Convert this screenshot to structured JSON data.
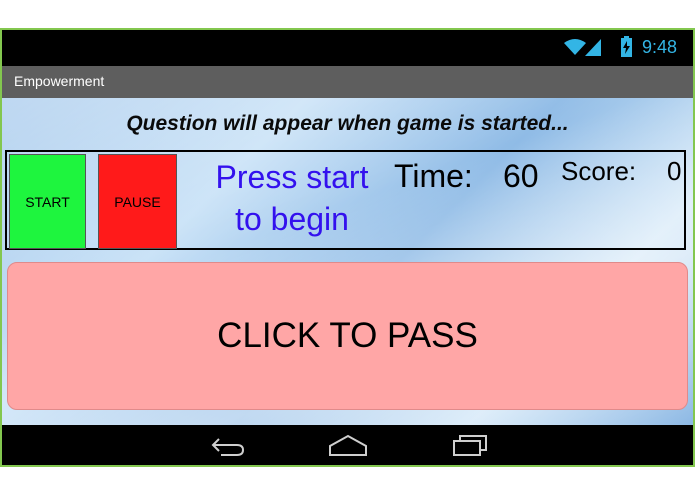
{
  "status_bar": {
    "time": "9:48",
    "icons": [
      "wifi-icon",
      "signal-icon",
      "battery-charging-icon"
    ],
    "accent_color": "#33b5e5"
  },
  "app": {
    "title": "Empowerment"
  },
  "game": {
    "question": "Question will appear when game is started...",
    "start_label": "START",
    "pause_label": "PAUSE",
    "message_line1": "Press start",
    "message_line2": "to begin",
    "time_label": "Time:",
    "time_value": "60",
    "score_label": "Score:",
    "score_value": "0",
    "pass_label": "CLICK TO PASS",
    "colors": {
      "start": "#1ef53e",
      "pause": "#ff1a1a",
      "pass": "#ffa6a6",
      "message": "#3311ee"
    }
  },
  "nav_bar": {
    "icons": [
      "back-icon",
      "home-icon",
      "recent-apps-icon"
    ]
  }
}
